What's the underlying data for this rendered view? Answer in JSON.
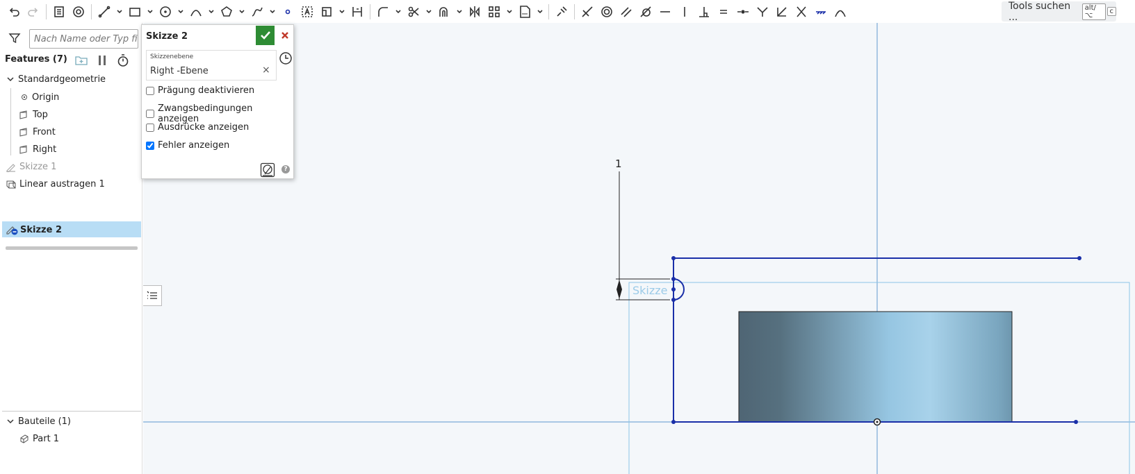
{
  "toolbar": {
    "search_label": "Tools suchen ...",
    "shortcut_keys": [
      "alt/⌥",
      "c"
    ]
  },
  "feature_tree": {
    "search_placeholder": "Nach Name oder Typ fi",
    "title": "Features (7)",
    "default_geometry": "Standardgeometrie",
    "items": [
      "Origin",
      "Top",
      "Front",
      "Right"
    ],
    "features": [
      "Skizze 1",
      "Linear austragen 1",
      "Skizze 2"
    ],
    "parts_title": "Bauteile (1)",
    "parts": [
      "Part 1"
    ]
  },
  "sketch_dialog": {
    "title": "Skizze 2",
    "plane_label": "Skizzenebene",
    "plane_value": "Right -Ebene",
    "options": [
      {
        "label": "Prägung deaktivieren",
        "checked": false
      },
      {
        "label": "Zwangsbedingungen anzeigen",
        "checked": false
      },
      {
        "label": "Ausdrücke anzeigen",
        "checked": false
      },
      {
        "label": "Fehler anzeigen",
        "checked": true
      }
    ]
  },
  "viewport": {
    "dimension_value": "1",
    "sketch_label": "Skizze",
    "colors": {
      "sketch_line": "#1a2fa8",
      "plane_outline": "#8cc4e8",
      "axis": "#7aaad6",
      "background": "#f4f7fa",
      "part_dark": "#4f6574",
      "part_light": "#a8d2ea",
      "selection": "#b8ddf5",
      "ok_green": "#2e8c34",
      "cancel_red": "#c0392b"
    }
  }
}
